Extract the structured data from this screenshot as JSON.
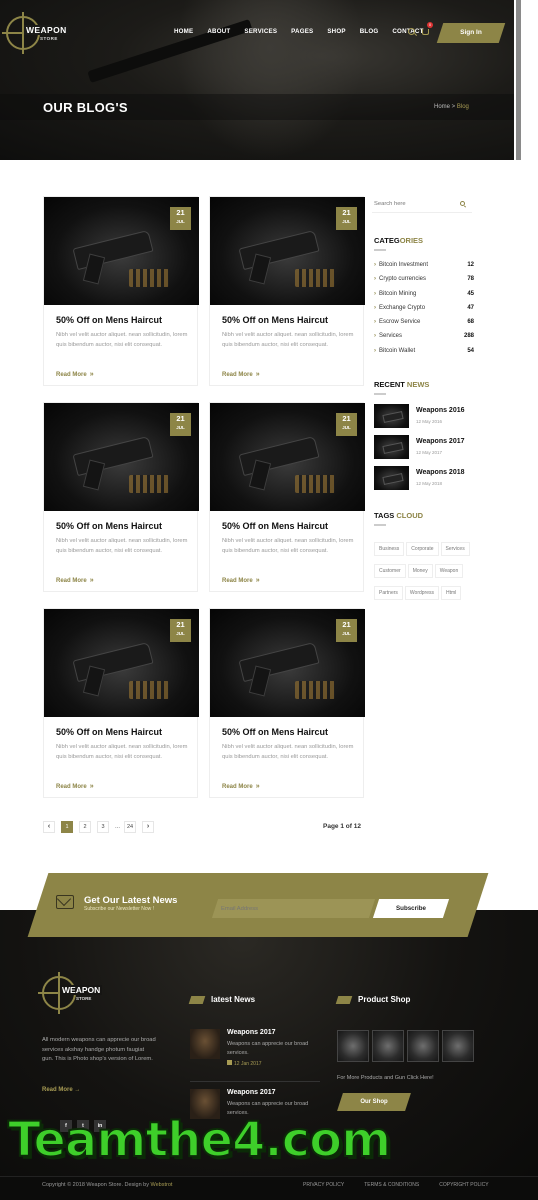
{
  "brand": {
    "name": "WEAPON",
    "sub": "STORE"
  },
  "nav": [
    "HOME",
    "ABOUT",
    "SERVICES",
    "PAGES",
    "SHOP",
    "BLOG",
    "CONTACT"
  ],
  "cart_count": "0",
  "signin_label": "Sign In",
  "hero": {
    "title": "OUR BLOG'S",
    "crumb_home": "Home",
    "crumb_sep": " > ",
    "crumb_current": "Blog"
  },
  "posts": [
    {
      "day": "21",
      "month": "JUL",
      "title": "50% Off on Mens Haircut",
      "excerpt": "Nibh vel velit auctor aliquet. nean sollicitudin, lorem quis bibendum auctor, nisi elit consequat.",
      "more": "Read More"
    },
    {
      "day": "21",
      "month": "JUL",
      "title": "50% Off on Mens Haircut",
      "excerpt": "Nibh vel velit auctor aliquet. nean sollicitudin, lorem quis bibendum auctor, nisi elit consequat.",
      "more": "Read More"
    },
    {
      "day": "21",
      "month": "JUL",
      "title": "50% Off on Mens Haircut",
      "excerpt": "Nibh vel velit auctor aliquet. nean sollicitudin, lorem quis bibendum auctor, nisi elit consequat.",
      "more": "Read More"
    },
    {
      "day": "21",
      "month": "JUL",
      "title": "50% Off on Mens Haircut",
      "excerpt": "Nibh vel velit auctor aliquet. nean sollicitudin, lorem quis bibendum auctor, nisi elit consequat.",
      "more": "Read More"
    },
    {
      "day": "21",
      "month": "JUL",
      "title": "50% Off on Mens Haircut",
      "excerpt": "Nibh vel velit auctor aliquet. nean sollicitudin, lorem quis bibendum auctor, nisi elit consequat.",
      "more": "Read More"
    },
    {
      "day": "21",
      "month": "JUL",
      "title": "50% Off on Mens Haircut",
      "excerpt": "Nibh vel velit auctor aliquet. nean sollicitudin, lorem quis bibendum auctor, nisi elit consequat.",
      "more": "Read More"
    }
  ],
  "pagination": {
    "prev": "‹",
    "pages": [
      "1",
      "2",
      "3"
    ],
    "dots": "...",
    "last": "24",
    "next": "›",
    "current": "1",
    "label": "Page 1 of 12"
  },
  "sidebar": {
    "search_placeholder": "Search here",
    "categories_title_a": "CATEG",
    "categories_title_b": "ORIES",
    "categories": [
      {
        "name": "Bitcoin Investment",
        "count": "12"
      },
      {
        "name": "Crypto currencies",
        "count": "78"
      },
      {
        "name": "Bitcoin Mining",
        "count": "45"
      },
      {
        "name": "Exchange Crypto",
        "count": "47"
      },
      {
        "name": "Escrow Service",
        "count": "68"
      },
      {
        "name": "Services",
        "count": "288"
      },
      {
        "name": "Bitcoin Wallet",
        "count": "54"
      }
    ],
    "recent_title_a": "RECENT ",
    "recent_title_b": "NEWS",
    "recent": [
      {
        "title": "Weapons 2016",
        "date": "12 May 2016"
      },
      {
        "title": "Weapons 2017",
        "date": "12 May 2017"
      },
      {
        "title": "Weapons 2018",
        "date": "12 May 2018"
      }
    ],
    "tags_title_a": "TAGS ",
    "tags_title_b": "CLOUD",
    "tags": [
      "Business",
      "Corporate",
      "Services",
      "Customer",
      "Money",
      "Weapon",
      "Partners",
      "Wordpress",
      "Html"
    ]
  },
  "newsletter": {
    "title": "Get Our Latest News",
    "sub": "Subscribe our Newsletter Now !",
    "placeholder": "Email Address",
    "button": "Subscribe"
  },
  "footer": {
    "about": "All modern weapons can apprecie our broad services akshay handge photum faugiat gun. This is Photo shop's version of Lorem.",
    "read_more": "Read More",
    "news_title": "latest News",
    "news": [
      {
        "title": "Weapons 2017",
        "excerpt": "Weapons can apprecie our broad services.",
        "date": "12 Jan 2017"
      },
      {
        "title": "Weapons 2017",
        "excerpt": "Weapons can apprecie our broad services.",
        "date": ""
      }
    ],
    "shop_title": "Product Shop",
    "shop_note": "For More Products and Gun Click Here!",
    "shop_button": "Our Shop",
    "social": [
      "f",
      "t",
      "in"
    ],
    "copyright_a": "Copyright © 2018 Weapon Store. Design by ",
    "copyright_b": "Webstrot",
    "links": [
      "PRIVACY POLICY",
      "TERMS & CONDITIONS",
      "COPYRIGHT POLICY"
    ]
  },
  "watermark": "Teamthe4.com",
  "colors": {
    "accent": "#8d8547",
    "dark": "#111111"
  }
}
